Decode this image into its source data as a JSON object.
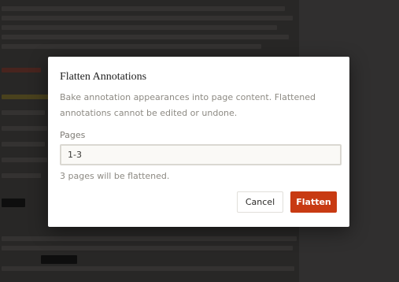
{
  "dialog": {
    "title": "Flatten Annotations",
    "description": "Bake annotation appearances into page content. Flattened annotations cannot be edited or undone.",
    "pages_label": "Pages",
    "pages_value": "1-3",
    "hint": "3 pages will be flattened.",
    "cancel_label": "Cancel",
    "confirm_label": "Flatten"
  },
  "colors": {
    "accent": "#c83a12",
    "dialog_bg": "#ffffff",
    "backdrop": "#3a3938"
  }
}
